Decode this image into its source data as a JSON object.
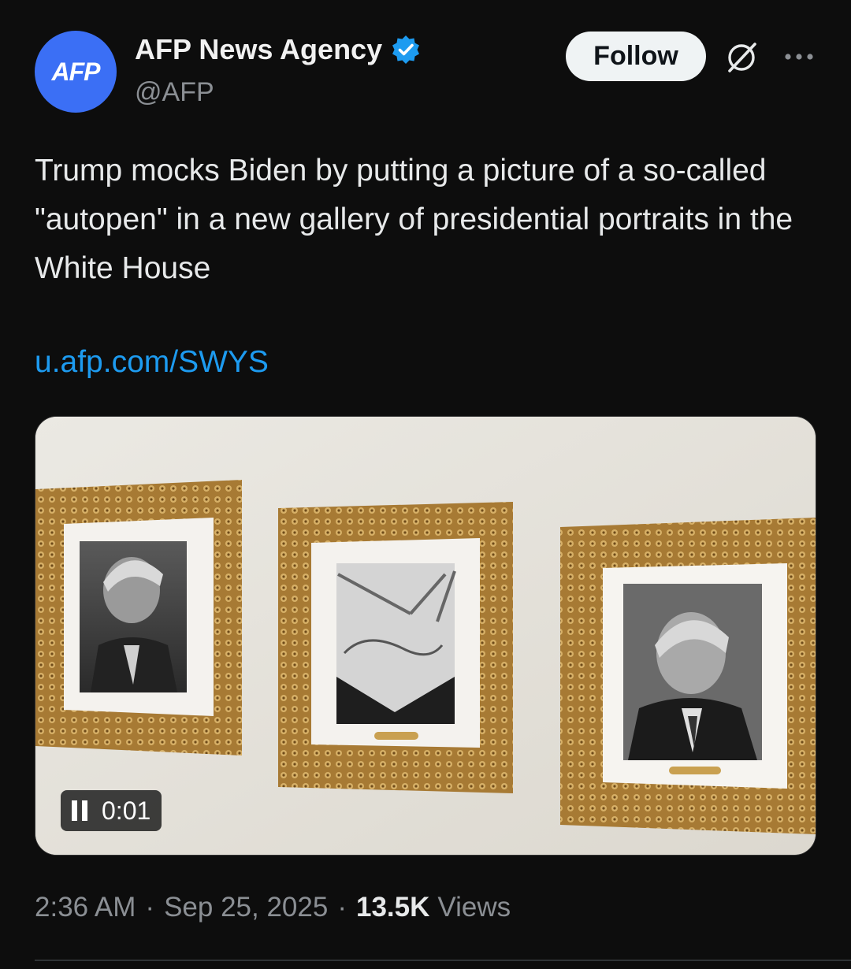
{
  "author": {
    "avatar_text": "AFP",
    "display_name": "AFP News Agency",
    "handle": "@AFP",
    "verified": true
  },
  "actions": {
    "follow_label": "Follow",
    "grok_icon": "grok-icon",
    "more_icon": "more-options-icon"
  },
  "tweet": {
    "text": "Trump mocks Biden by putting a picture of a so-called \"autopen\" in a new gallery of presidential portraits in the White House",
    "link": "u.afp.com/SWYS"
  },
  "media": {
    "type": "video",
    "time": "0:01",
    "state_icon": "pause-icon"
  },
  "meta": {
    "time": "2:36 AM",
    "date": "Sep 25, 2025",
    "views_count": "13.5K",
    "views_label": "Views"
  },
  "colors": {
    "background": "#0d0d0d",
    "link": "#1d9bf0",
    "verified": "#1d9bf0",
    "avatar": "#3b6ff5"
  }
}
